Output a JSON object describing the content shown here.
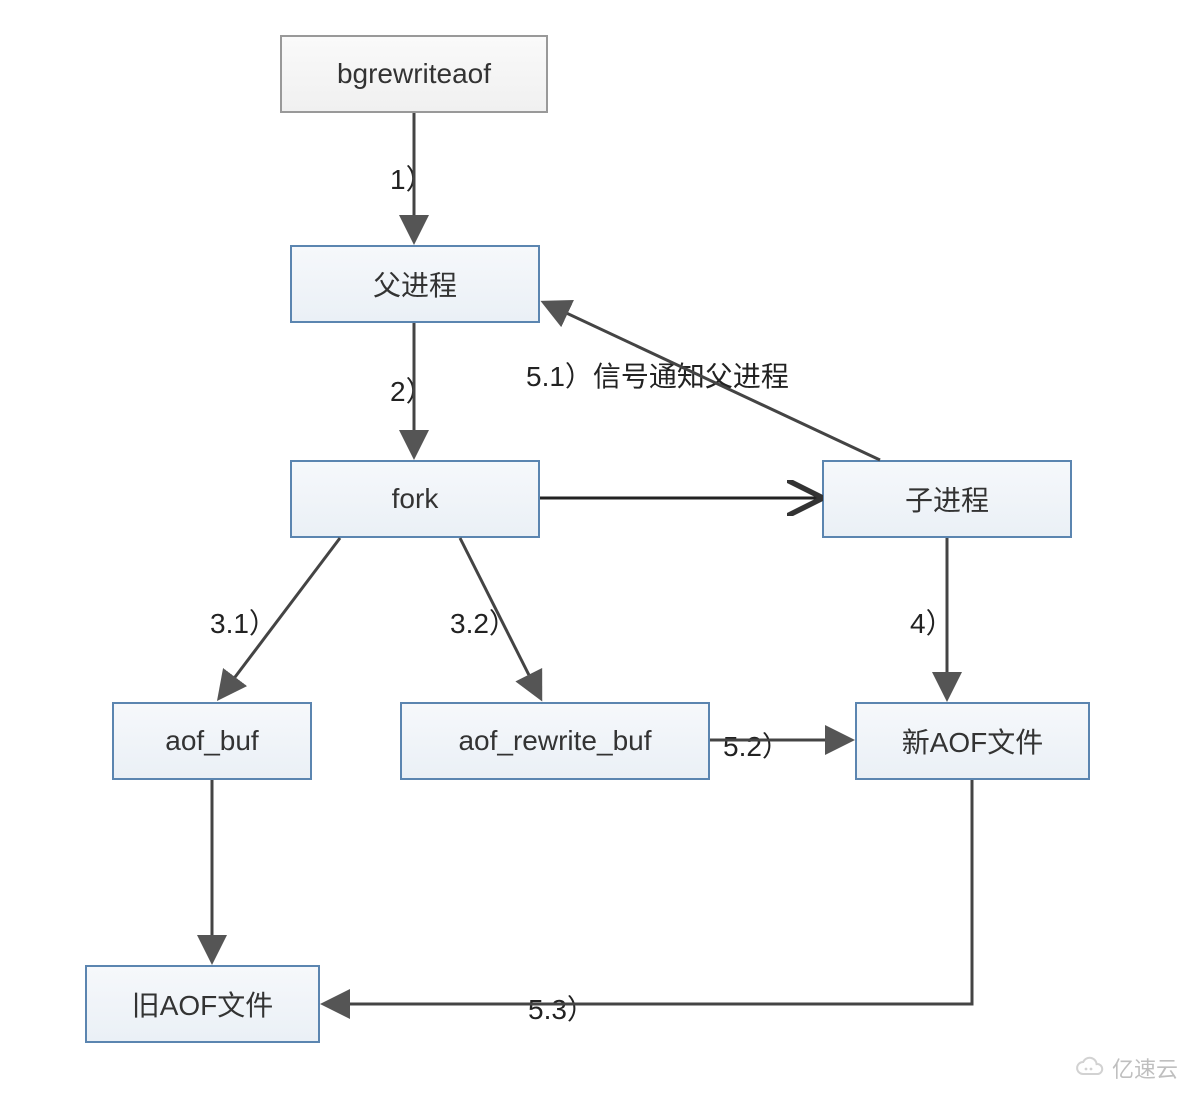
{
  "diagram": {
    "title": "AOF rewrite flow",
    "nodes": {
      "bgrewriteaof": "bgrewriteaof",
      "parent_process": "父进程",
      "fork": "fork",
      "child_process": "子进程",
      "aof_buf": "aof_buf",
      "aof_rewrite_buf": "aof_rewrite_buf",
      "new_aof_file": "新AOF文件",
      "old_aof_file": "旧AOF文件"
    },
    "edges": {
      "e1": "1）",
      "e2": "2）",
      "e3_1": "3.1）",
      "e3_2": "3.2）",
      "e4": "4）",
      "e5_1": "5.1）信号通知父进程 ",
      "e5_2": "5.2）",
      "e5_3": "5.3）"
    }
  },
  "watermark": {
    "text": "亿速云"
  }
}
